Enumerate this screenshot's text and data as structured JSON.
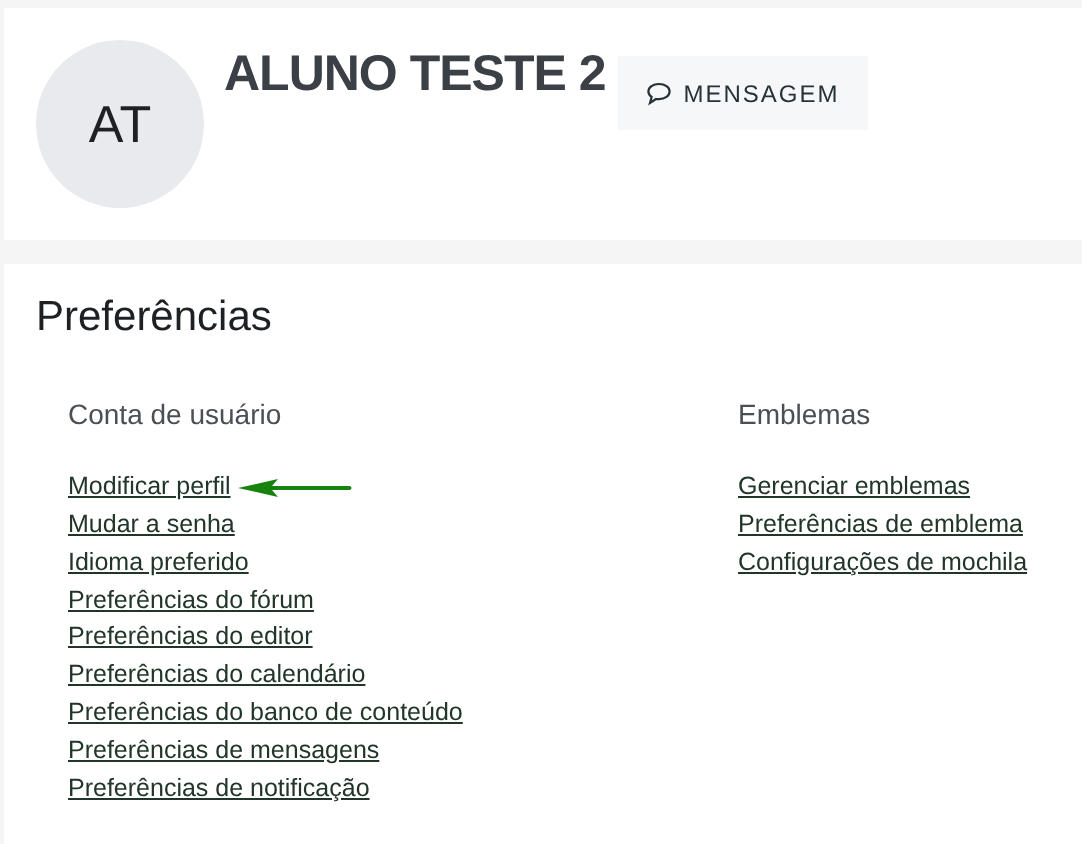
{
  "profile": {
    "initials": "AT",
    "name": "ALUNO TESTE 2",
    "message_button": "MENSAGEM"
  },
  "preferences": {
    "title": "Preferências",
    "sections": [
      {
        "title": "Conta de usuário",
        "links": [
          {
            "label": "Modificar perfil",
            "highlighted": true
          },
          {
            "label": "Mudar a senha",
            "highlighted": false
          },
          {
            "label": "Idioma preferido",
            "highlighted": false
          },
          {
            "label": "Preferências do fórum",
            "highlighted": false
          },
          {
            "label": "Preferências do editor",
            "highlighted": false
          },
          {
            "label": "Preferências do calendário",
            "highlighted": false
          },
          {
            "label": "Preferências do banco de conteúdo",
            "highlighted": false
          },
          {
            "label": "Preferências de mensagens",
            "highlighted": false
          },
          {
            "label": "Preferências de notificação",
            "highlighted": false
          }
        ]
      },
      {
        "title": "Emblemas",
        "links": [
          {
            "label": "Gerenciar emblemas",
            "highlighted": false
          },
          {
            "label": "Preferências de emblema",
            "highlighted": false
          },
          {
            "label": "Configurações de mochila",
            "highlighted": false
          }
        ]
      }
    ]
  }
}
